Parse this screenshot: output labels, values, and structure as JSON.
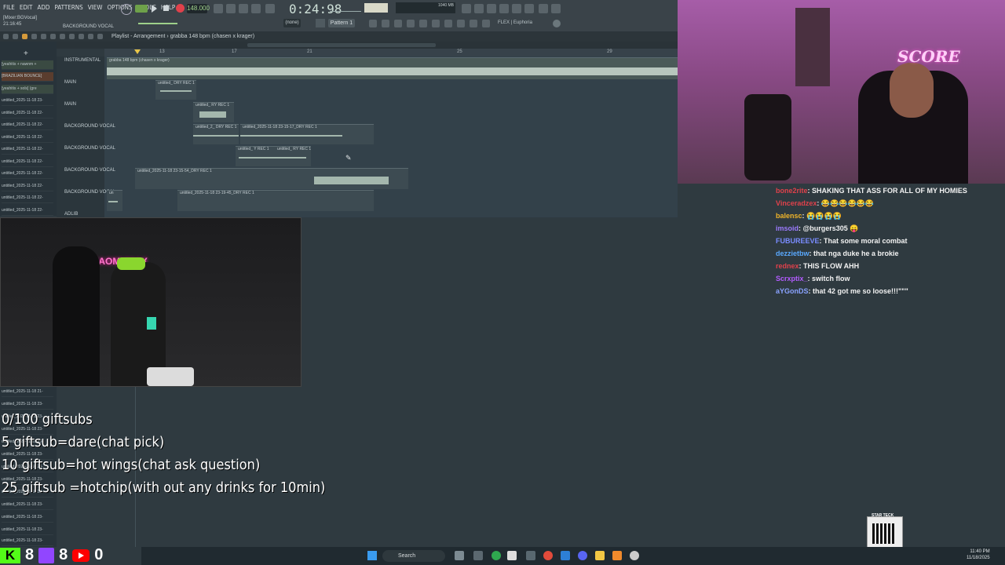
{
  "fl_studio": {
    "menu": [
      "FILE",
      "EDIT",
      "ADD",
      "PATTERNS",
      "VIEW",
      "OPTIONS",
      "TOOLS",
      "HELP"
    ],
    "time_display": "0:24:98",
    "tempo": "148.000",
    "pattern_label": "Pattern 1",
    "none_label": "(none)",
    "cpu_info": "1040 MB",
    "plugin_label": "FLEX | Euphoria",
    "hint_panel": {
      "line1": "[Mixer:BGVocal]",
      "line2": "21:16:45"
    },
    "channel_hint": "BACKGROUND VOCAL",
    "playlist_title": "Playlist - Arrangement › grabba 148 bpm (chasen x krager)",
    "ruler_marks": [
      "13",
      "17",
      "21",
      "25",
      "29"
    ],
    "browser_items": [
      "[yeahitis + nawnm +",
      "[BRAZILIAN BOUNCE]",
      "[yeahitis + sols] (gre",
      "untitled_2025-11-18 23-",
      "untitled_2025-11-18 22-",
      "untitled_2025-11-18 22-",
      "untitled_2025-11-18 22-",
      "untitled_2025-11-18 22-",
      "untitled_2025-11-18 22-",
      "untitled_2025-11-18 22-",
      "untitled_2025-11-18 22-",
      "untitled_2025-11-18 22-",
      "untitled_2025-11-18 22-",
      "untitled_2025-11-18 22-"
    ],
    "lower_browser_items": [
      "untitled_2025-11-18 21-",
      "untitled_2025-11-18 23-",
      "untitled_2025-11-18 23-",
      "untitled_2025-11-18 23-",
      "untitled_2025-11-18 23-",
      "untitled_2025-11-18 23-",
      "untitled_2025-11-18 23-",
      "untitled_2025-11-18 23-",
      "untitled_2025-11-18 23-",
      "untitled_2025-11-18 23-",
      "untitled_2025-11-18 23-",
      "untitled_2025-11-18 23-",
      "untitled_2025-11-18 23-"
    ],
    "track_names": [
      "INSTRUMENTAL",
      "MAIN",
      "MAIN",
      "BACKGROUND VOCAL",
      "BACKGROUND VOCAL",
      "BACKGROUND VOCAL",
      "BACKGROUND VOCAL",
      "ADLIB"
    ],
    "clips": [
      "grabba 148 bpm (chasen x krager)",
      "untitled_ DRY REC 1",
      "untitled_ RY REC 1",
      "untitled_2_ DRY REC 1",
      "untitled_2025-11-18 23-15-17_DRY REC 1",
      "untitled_ Y REC 1",
      "untitled_ RY REC 1",
      "untitled_2025-11-18 23-15-54_DRY REC 1",
      "untitled_2025-11-18 23-19-45_DRY REC 1",
      "un"
    ]
  },
  "chat": [
    {
      "user": "bone2rite",
      "message": "SHAKING THAT ASS FOR ALL OF MY HOMIES",
      "color": "#e0414b"
    },
    {
      "user": "Vinceradzex",
      "message": "😂😂😂😂😂😂",
      "color": "#e0414b"
    },
    {
      "user": "balensc",
      "message": "😭😭😭😭",
      "color": "#f0b429"
    },
    {
      "user": "imsoid",
      "message": "@burgers305 😛",
      "color": "#9c7bff"
    },
    {
      "user": "FUBUREEVE",
      "message": "That some moral combat",
      "color": "#7a8cff"
    },
    {
      "user": "dezzietbw",
      "message": "that nga duke he a brokie",
      "color": "#5aa9ff"
    },
    {
      "user": "rednex",
      "message": "THIS FLOW AHH",
      "color": "#e0414b"
    },
    {
      "user": "Scrxptix_",
      "message": "switch flow",
      "color": "#b35cff"
    },
    {
      "user": "aYGonDS",
      "message": "that 42 got me so loose!!!\"\"\"",
      "color": "#8aa2ff"
    }
  ],
  "goals": [
    "0/100 giftsubs",
    "5 giftsub=dare(chat pick)",
    "10 giftsub=hot wings(chat ask question)",
    "25 giftsub =hotchip(with out any drinks for 10min)"
  ],
  "social": {
    "kick_count": "8",
    "twitch_count": "8",
    "youtube_count": "0"
  },
  "taskbar": {
    "search": "Search",
    "time": "11:40 PM",
    "date": "11/18/2025"
  },
  "cam_overlay_text": "GAOMYMAX",
  "cam_main_logo": "SCORE",
  "qr_label": "STAR TECK",
  "colors": {
    "chat_text": "#f2f2f2",
    "kick": "#53fc18",
    "twitch": "#9146ff",
    "youtube": "#ff0000"
  }
}
